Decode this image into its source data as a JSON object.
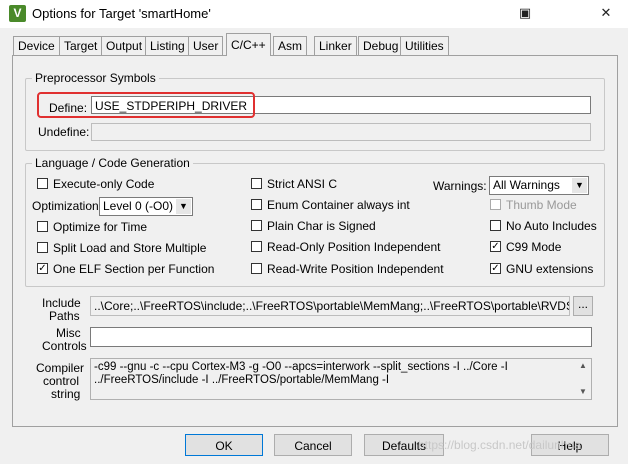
{
  "window": {
    "title": "Options for Target 'smartHome'",
    "help_glyph": "▣",
    "close_glyph": "✕",
    "icon_letter": "V"
  },
  "tabs": [
    "Device",
    "Target",
    "Output",
    "Listing",
    "User",
    "C/C++",
    "Asm",
    "Linker",
    "Debug",
    "Utilities"
  ],
  "active_tab": "C/C++",
  "preprocessor": {
    "legend": "Preprocessor Symbols",
    "define_label": "Define:",
    "define_value": "USE_STDPERIPH_DRIVER",
    "undefine_label": "Undefine:",
    "undefine_value": ""
  },
  "language": {
    "legend": "Language / Code Generation",
    "execute_only": {
      "label": "Execute-only Code",
      "checked": false
    },
    "optimization_label": "Optimization:",
    "optimization_value": "Level 0 (-O0)",
    "optimize_time": {
      "label": "Optimize for Time",
      "checked": false
    },
    "split_load": {
      "label": "Split Load and Store Multiple",
      "checked": false
    },
    "one_elf": {
      "label": "One ELF Section per Function",
      "checked": true
    },
    "strict_ansi": {
      "label": "Strict ANSI C",
      "checked": false
    },
    "enum_container": {
      "label": "Enum Container always int",
      "checked": false
    },
    "plain_char": {
      "label": "Plain Char is Signed",
      "checked": false
    },
    "ro_pos": {
      "label": "Read-Only Position Independent",
      "checked": false
    },
    "rw_pos": {
      "label": "Read-Write Position Independent",
      "checked": false
    },
    "warnings_label": "Warnings:",
    "warnings_value": "All Warnings",
    "thumb_mode": {
      "label": "Thumb Mode",
      "checked": false,
      "disabled": true
    },
    "no_auto_includes": {
      "label": "No Auto Includes",
      "checked": false
    },
    "c99_mode": {
      "label": "C99 Mode",
      "checked": true
    },
    "gnu_extensions": {
      "label": "GNU extensions",
      "checked": true
    }
  },
  "include_paths": {
    "label_line1": "Include",
    "label_line2": "Paths",
    "value": "..\\Core;..\\FreeRTOS\\include;..\\FreeRTOS\\portable\\MemMang;..\\FreeRTOS\\portable\\RVDS\\ARM_",
    "browse_label": "..."
  },
  "misc_controls": {
    "label_line1": "Misc",
    "label_line2": "Controls",
    "value": ""
  },
  "compiler_string": {
    "label_line1": "Compiler",
    "label_line2": "control",
    "label_line3": "string",
    "value": "-c99 --gnu -c --cpu Cortex-M3 -g -O0 --apcs=interwork --split_sections -I ../Core -I\n../FreeRTOS/include -I ../FreeRTOS/portable/MemMang -I",
    "scroll_up": "▲",
    "scroll_down": "▼"
  },
  "buttons": {
    "ok": "OK",
    "cancel": "Cancel",
    "defaults": "Defaults",
    "help": "Help"
  },
  "watermark": "https://blog.csdn.net/dailunhua"
}
